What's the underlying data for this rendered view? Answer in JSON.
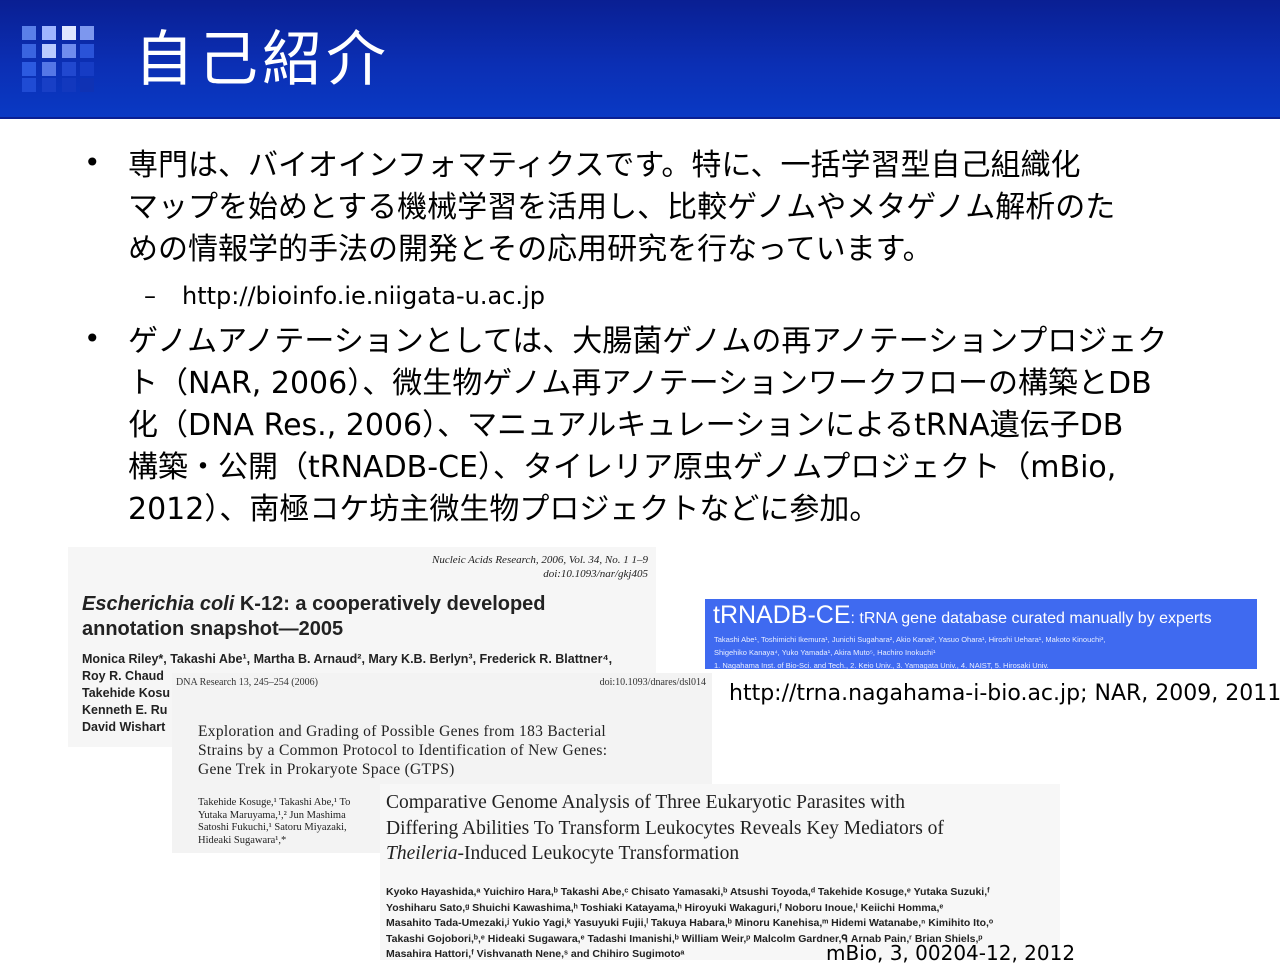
{
  "slide": {
    "title": "自己紹介",
    "bullet_symbol": "•",
    "dash_symbol": "–",
    "bullet1_lines": [
      "専門は、バイオインフォマティクスです。特に、一括学習型自己組織化",
      "マップを始めとする機械学習を活用し、比較ゲノムやメタゲノム解析のた",
      "めの情報学的手法の開発とその応用研究を行なっています。"
    ],
    "sub1": "http://bioinfo.ie.niigata-u.ac.jp",
    "bullet2_lines": [
      "ゲノムアノテーションとしては、大腸菌ゲノムの再アノテーションプロジェク",
      "ト（NAR, 2006）、微生物ゲノム再アノテーションワークフローの構築とDB",
      "化（DNA Res., 2006）、マニュアルキュレーションによるtRNA遺伝子DB",
      "構築・公開（tRNADB-CE）、タイレリア原虫ゲノムプロジェクト（mBio,",
      "2012）、南極コケ坊主微生物プロジェクトなどに参加。"
    ]
  },
  "colors": {
    "header": "#0b2fb4",
    "banner": "#3f6af0"
  },
  "paper1": {
    "journal_lines": [
      "Nucleic Acids Research, 2006, Vol. 34, No. 1   1–9",
      "doi:10.1093/nar/gkj405"
    ],
    "title_italic": "Escherichia coli",
    "title_rest": " K-12: a cooperatively developed",
    "title_line2": "annotation snapshot—2005",
    "author_lines": [
      "Monica Riley*, Takashi Abe¹, Martha B. Arnaud², Mary K.B. Berlyn³, Frederick R. Blattner⁴,",
      "Roy R. Chaud",
      "Takehide Kosu",
      "Kenneth E. Ru",
      "David Wishart"
    ]
  },
  "paper2": {
    "header_left": "DNA Research 13, 245–254 (2006)",
    "header_right": "doi:10.1093/dnares/dsl014",
    "title_lines": [
      "Exploration and Grading of Possible Genes from 183 Bacterial",
      "Strains by a Common Protocol to Identification of New Genes:",
      "Gene Trek in Prokaryote Space (GTPS)"
    ],
    "author_lines": [
      "Takehide Kosuge,¹ Takashi Abe,¹ To",
      "Yutaka Maruyama,¹,² Jun Mashima",
      "Satoshi Fukuchi,¹ Satoru Miyazaki,",
      "Hideaki Sugawara¹,*"
    ]
  },
  "paper3": {
    "title_lines": [
      "Comparative Genome Analysis of Three Eukaryotic Parasites with",
      "Differing Abilities To Transform Leukocytes Reveals Key Mediators of"
    ],
    "title_line3_italic": "Theileria",
    "title_line3_rest": "-Induced Leukocyte Transformation",
    "author_lines": [
      "Kyoko Hayashida,ᵃ Yuichiro Hara,ᵇ Takashi Abe,ᶜ Chisato Yamasaki,ᵇ Atsushi Toyoda,ᵈ Takehide Kosuge,ᵉ Yutaka Suzuki,ᶠ",
      "Yoshiharu Sato,ᵍ Shuichi Kawashima,ʰ Toshiaki Katayama,ʰ Hiroyuki Wakaguri,ᶠ Noboru Inoue,ⁱ Keiichi Homma,ᵉ",
      "Masahito Tada-Umezaki,ʲ Yukio Yagi,ᵏ Yasuyuki Fujii,ˡ Takuya Habara,ᵇ Minoru Kanehisa,ᵐ Hidemi Watanabe,ⁿ Kimihito Ito,ᵒ",
      "Takashi Gojobori,ᵇ,ᵉ Hideaki Sugawara,ᵉ Tadashi Imanishi,ᵇ William Weir,ᵖ Malcolm Gardner,ᑫ Arnab Pain,ʳ Brian Shiels,ᵖ",
      "Masahira Hattori,ᶠ Vishvanath Nene,ˢ and Chihiro Sugimotoᵃ"
    ]
  },
  "trnadb": {
    "name": "tRNADB-CE",
    "subtitle": ": tRNA gene database curated manually by experts",
    "authors": "Takashi Abe¹, Toshimichi Ikemura¹, Junichi Sugahara², Akio Kanai², Yasuo Ohara¹, Hiroshi Uehara¹, Makoto Kinouchi³,",
    "authors2": "Shigehiko Kanaya⁴, Yuko Yamada¹, Akira Muto⁵, Hachiro Inokuchi¹",
    "affil": "1. Nagahama Inst. of Bio-Sci. and Tech., 2. Keio Univ., 3. Yamagata Univ., 4. NAIST, 5. Hirosaki Univ."
  },
  "captions": {
    "trna": "http://trna.nagahama-i-bio.ac.jp; NAR, 2009, 2011",
    "mbio": "mBio, 3, 00204-12, 2012"
  }
}
